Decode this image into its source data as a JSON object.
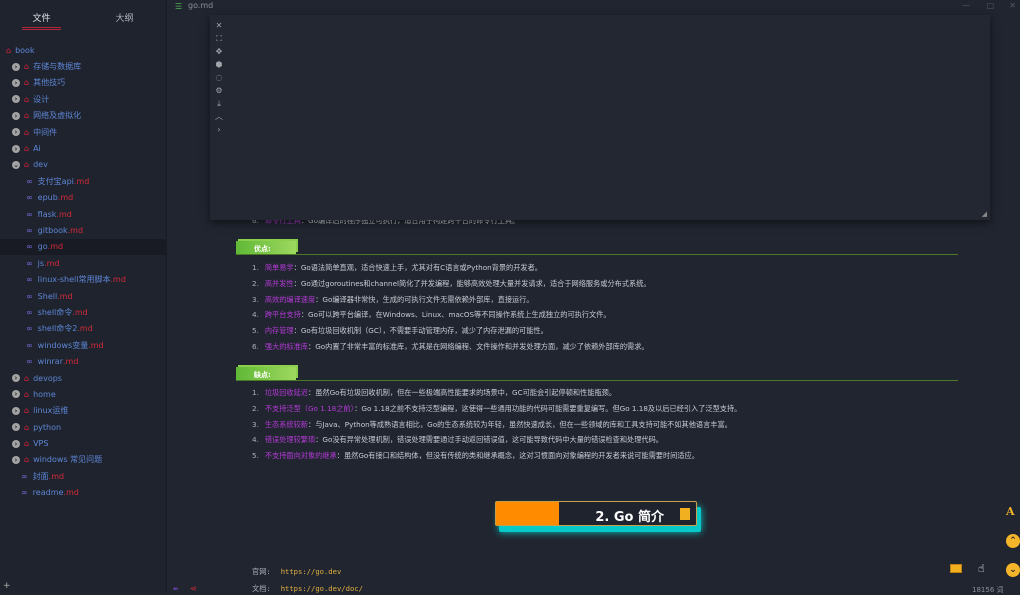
{
  "sidebar": {
    "tabs": [
      "文件",
      "大纲"
    ],
    "tree": [
      {
        "label": "book",
        "type": "root"
      },
      {
        "label": "存储与数据库",
        "type": "folder"
      },
      {
        "label": "其他技巧",
        "type": "folder"
      },
      {
        "label": "设计",
        "type": "folder"
      },
      {
        "label": "网络及虚拟化",
        "type": "folder"
      },
      {
        "label": "中间件",
        "type": "folder"
      },
      {
        "label": "Ai",
        "type": "folder"
      },
      {
        "label": "dev",
        "type": "folder-open"
      },
      {
        "label": "支付宝api",
        "ext": ".md",
        "type": "file"
      },
      {
        "label": "epub",
        "ext": ".md",
        "type": "file"
      },
      {
        "label": "flask",
        "ext": ".md",
        "type": "file"
      },
      {
        "label": "gitbook",
        "ext": ".md",
        "type": "file"
      },
      {
        "label": "go",
        "ext": ".md",
        "type": "file",
        "selected": true
      },
      {
        "label": "js",
        "ext": ".md",
        "type": "file"
      },
      {
        "label": "linux-shell常用脚本",
        "ext": ".md",
        "type": "file"
      },
      {
        "label": "Shell",
        "ext": ".md",
        "type": "file"
      },
      {
        "label": "shell命令",
        "ext": ".md",
        "type": "file"
      },
      {
        "label": "shell命令2",
        "ext": ".md",
        "type": "file"
      },
      {
        "label": "windows变量",
        "ext": ".md",
        "type": "file"
      },
      {
        "label": "winrar",
        "ext": ".md",
        "type": "file"
      },
      {
        "label": "devops",
        "type": "folder"
      },
      {
        "label": "home",
        "type": "folder"
      },
      {
        "label": "linux运维",
        "type": "folder"
      },
      {
        "label": "python",
        "type": "folder"
      },
      {
        "label": "VPS",
        "type": "folder"
      },
      {
        "label": "windows 常见问题",
        "type": "folder"
      },
      {
        "label": "封面",
        "ext": ".md",
        "type": "rootfile"
      },
      {
        "label": "readme",
        "ext": ".md",
        "type": "rootfile"
      }
    ]
  },
  "titlebar": {
    "filename": "go.md"
  },
  "panel": {
    "tools": [
      "close-icon",
      "fullscreen-icon",
      "move-icon",
      "cube-icon",
      "circle-icon",
      "gear-icon",
      "download-icon",
      "chevron-up-icon",
      "chevron-right-icon"
    ]
  },
  "content": {
    "partial_line": {
      "num": "6.",
      "key": "命令行工具",
      "text": "：Go编译后的程序独立可执行，适合用于构建跨平台的命令行工具。"
    },
    "pros_title": "优点:",
    "pros": [
      {
        "num": "1.",
        "key": "简单易学",
        "text": "：Go语法简单直观，适合快速上手，尤其对有C语言或Python背景的开发者。"
      },
      {
        "num": "2.",
        "key": "高并发性",
        "text": "：Go通过goroutines和channel简化了并发编程，能够高效处理大量并发请求，适合于网络服务或分布式系统。"
      },
      {
        "num": "3.",
        "key": "高效的编译速度",
        "text": "：Go编译器非常快，生成的可执行文件无需依赖外部库，直接运行。"
      },
      {
        "num": "4.",
        "key": "跨平台支持",
        "text": "：Go可以跨平台编译，在Windows、Linux、macOS等不同操作系统上生成独立的可执行文件。"
      },
      {
        "num": "5.",
        "key": "内存管理",
        "text": "：Go有垃圾回收机制（GC），不需要手动管理内存，减少了内存泄漏的可能性。"
      },
      {
        "num": "6.",
        "key": "强大的标准库",
        "text": "：Go内置了非常丰富的标准库，尤其是在网络编程、文件操作和并发处理方面，减少了依赖外部库的需求。"
      }
    ],
    "cons_title": "缺点:",
    "cons": [
      {
        "num": "1.",
        "key": "垃圾回收延迟",
        "text": "：虽然Go有垃圾回收机制，但在一些极端高性能要求的场景中，GC可能会引起停顿和性能瓶颈。"
      },
      {
        "num": "2.",
        "key": "不支持泛型（Go 1.18之前）",
        "text": "：Go 1.18之前不支持泛型编程，这使得一些通用功能的代码可能需要重复编写。但Go 1.18及以后已经引入了泛型支持。"
      },
      {
        "num": "3.",
        "key": "生态系统较新",
        "text": "：与Java、Python等成熟语言相比，Go的生态系统较为年轻，虽然快速成长，但在一些领域的库和工具支持可能不如其他语言丰富。"
      },
      {
        "num": "4.",
        "key": "错误处理较繁琐",
        "text": "：Go没有异常处理机制，错误处理需要通过手动返回错误值，这可能导致代码中大量的错误检查和处理代码。"
      },
      {
        "num": "5.",
        "key": "不支持面向对象的继承",
        "text": "：虽然Go有接口和结构体，但没有传统的类和继承概念，这对习惯面向对象编程的开发者来说可能需要时间适应。"
      }
    ],
    "banner": "2. Go 简介",
    "footer": [
      {
        "label": "官网:",
        "url": "https://go.dev"
      },
      {
        "label": "文档:",
        "url": "https://go.dev/doc/"
      }
    ]
  },
  "status": {
    "word_count": "18156 词"
  },
  "colors": {
    "accent_red": "#d42a3a",
    "banner_orange": "#ff8c00",
    "banner_glow": "#08c9c9",
    "key_purple": "#b43ad8",
    "url_gold": "#e0b040"
  }
}
